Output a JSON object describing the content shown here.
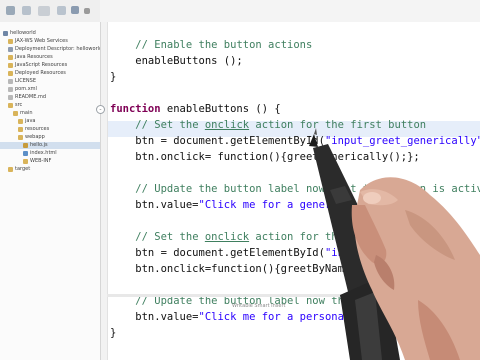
{
  "toolbar": {
    "icons": [
      "new-file-icon",
      "save-icon",
      "print-icon",
      "run-icon",
      "debug-icon",
      "menu-icon"
    ]
  },
  "explorer": {
    "items": [
      {
        "label": "helloworld",
        "icon": "project-icon",
        "level": 0,
        "selected": false
      },
      {
        "label": "JAX-WS Web Services",
        "icon": "folder-icon",
        "level": 1,
        "selected": false
      },
      {
        "label": "Deployment Descriptor: helloworld",
        "icon": "descriptor-icon",
        "level": 1,
        "selected": false
      },
      {
        "label": "Java Resources",
        "icon": "folder-icon",
        "level": 1,
        "selected": false
      },
      {
        "label": "JavaScript Resources",
        "icon": "folder-icon",
        "level": 1,
        "selected": false
      },
      {
        "label": "Deployed Resources",
        "icon": "folder-icon",
        "level": 1,
        "selected": false
      },
      {
        "label": "LICENSE",
        "icon": "file-icon",
        "level": 1,
        "selected": false
      },
      {
        "label": "pom.xml",
        "icon": "file-icon",
        "level": 1,
        "selected": false
      },
      {
        "label": "README.md",
        "icon": "file-icon",
        "level": 1,
        "selected": false
      },
      {
        "label": "src",
        "icon": "folder-icon",
        "level": 1,
        "selected": false
      },
      {
        "label": "main",
        "icon": "folder-icon",
        "level": 2,
        "selected": false
      },
      {
        "label": "java",
        "icon": "folder-icon",
        "level": 3,
        "selected": false
      },
      {
        "label": "resources",
        "icon": "folder-icon",
        "level": 3,
        "selected": false
      },
      {
        "label": "webapp",
        "icon": "folder-icon",
        "level": 3,
        "selected": false
      },
      {
        "label": "hello.js",
        "icon": "js-file-icon",
        "level": 4,
        "selected": true
      },
      {
        "label": "index.html",
        "icon": "html-file-icon",
        "level": 4,
        "selected": false
      },
      {
        "label": "WEB-INF",
        "icon": "folder-icon",
        "level": 4,
        "selected": false
      },
      {
        "label": "target",
        "icon": "folder-icon",
        "level": 1,
        "selected": false
      }
    ]
  },
  "editor": {
    "lines": [
      {
        "segments": [
          {
            "t": "    "
          },
          {
            "t": "// Enable the button actions",
            "c": "cm"
          }
        ]
      },
      {
        "segments": [
          {
            "t": "    enableButtons ();"
          }
        ]
      },
      {
        "segments": [
          {
            "t": "}"
          }
        ]
      },
      {
        "segments": [
          {
            "t": ""
          }
        ]
      },
      {
        "fold": "-",
        "segments": [
          {
            "t": "function",
            "c": "kw"
          },
          {
            "t": " enableButtons () {"
          }
        ]
      },
      {
        "segments": [
          {
            "t": "    "
          },
          {
            "t": "// Set the ",
            "c": "cm"
          },
          {
            "t": "onclick",
            "c": "cmu"
          },
          {
            "t": " action for the first button",
            "c": "cm"
          }
        ]
      },
      {
        "segments": [
          {
            "t": "    btn = document.getElementById("
          },
          {
            "t": "\"input_greet_generically\"",
            "c": "st"
          },
          {
            "t": ");"
          }
        ]
      },
      {
        "segments": [
          {
            "t": "    btn.onclick= function(){greetGenerically();};"
          }
        ]
      },
      {
        "segments": [
          {
            "t": ""
          }
        ]
      },
      {
        "segments": [
          {
            "t": "    "
          },
          {
            "t": "// Update the button label now that the button is active",
            "c": "cm"
          }
        ]
      },
      {
        "segments": [
          {
            "t": "    btn.value="
          },
          {
            "t": "\"Click me for a generic greeting\"",
            "c": "st"
          },
          {
            "t": ";"
          }
        ]
      },
      {
        "segments": [
          {
            "t": ""
          }
        ]
      },
      {
        "segments": [
          {
            "t": "    "
          },
          {
            "t": "// Set the ",
            "c": "cm"
          },
          {
            "t": "onclick",
            "c": "cmu"
          },
          {
            "t": " action for the second button",
            "c": "cm"
          }
        ]
      },
      {
        "segments": [
          {
            "t": "    btn = document.getElementById("
          },
          {
            "t": "\"input_greet_by_name\"",
            "c": "st"
          },
          {
            "t": ");"
          }
        ]
      },
      {
        "segments": [
          {
            "t": "    btn.onclick=function(){greetByName();};"
          }
        ]
      },
      {
        "segments": [
          {
            "t": ""
          }
        ]
      },
      {
        "segments": [
          {
            "t": "    "
          },
          {
            "t": "// Update the button label now that the button is active",
            "c": "cm"
          }
        ]
      },
      {
        "segments": [
          {
            "t": "    btn.value="
          },
          {
            "t": "\"Click me for a personal greeting\"",
            "c": "st"
          },
          {
            "t": ";"
          }
        ]
      },
      {
        "segments": [
          {
            "t": "}"
          }
        ]
      }
    ]
  },
  "status": {
    "text": "Writable    Smart Insert"
  },
  "colors": {
    "comment": "#3f7f5f",
    "keyword": "#7f0055",
    "string": "#2a00ff",
    "caret_line": "#e6eefa"
  }
}
